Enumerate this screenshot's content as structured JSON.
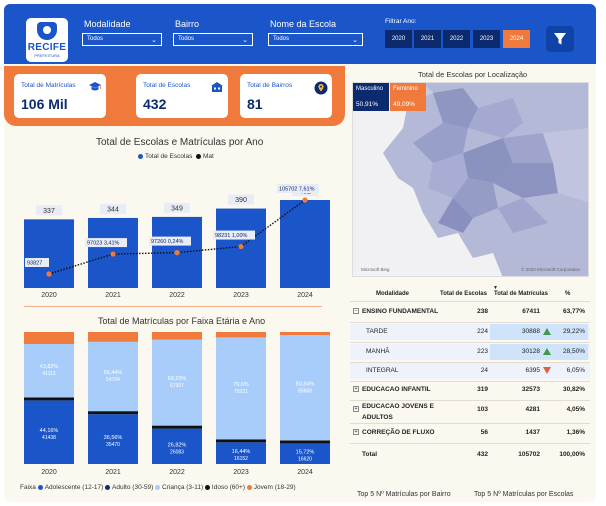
{
  "header": {
    "logo_text": "RECIFE",
    "logo_sub": "PREFEITURA",
    "filters": [
      {
        "label": "Modalidade",
        "value": "Todos"
      },
      {
        "label": "Bairro",
        "value": "Todos"
      },
      {
        "label": "Nome da Escola",
        "value": "Todos"
      }
    ],
    "year_filter_label": "Filtrar Ano:",
    "years": [
      "2020",
      "2021",
      "2022",
      "2023",
      "2024"
    ],
    "active_year": "2024"
  },
  "kpis": [
    {
      "label": "Total de Matrículas",
      "value": "106 Mil",
      "icon": "graduation-cap-icon"
    },
    {
      "label": "Total de Escolas",
      "value": "432",
      "icon": "school-icon"
    },
    {
      "label": "Total de Bairros",
      "value": "81",
      "icon": "location-pin-icon"
    }
  ],
  "colors": {
    "primary": "#1a55c9",
    "dark": "#0c2a6e",
    "accent": "#f07a3b",
    "light_blue": "#a9cdfa",
    "idoso": "#111111"
  },
  "chart_data": [
    {
      "type": "bar",
      "title": "Total de Escolas e Matrículas por Ano",
      "legend": [
        "Total de Escolas",
        "Mat"
      ],
      "categories": [
        "2020",
        "2021",
        "2022",
        "2023",
        "2024"
      ],
      "series": [
        {
          "name": "Total de Escolas",
          "values": [
            337,
            344,
            349,
            390,
            432
          ]
        },
        {
          "name": "Mat",
          "values": [
            93827,
            97023,
            97260,
            98231,
            105702
          ]
        }
      ],
      "growth_labels": [
        "",
        "3,41%",
        "0,24%",
        "1,00%",
        "7,61%"
      ]
    },
    {
      "type": "bar",
      "title": "Total de Matrículas por Faixa Etária e Ano",
      "legend_title": "Faixa",
      "categories": [
        "2020",
        "2021",
        "2022",
        "2023",
        "2024"
      ],
      "series": [
        {
          "name": "Adolescente (12-17)",
          "values": [
            0,
            0,
            0,
            0,
            0
          ]
        },
        {
          "name": "Adulto (30-59)",
          "values": [
            41438,
            35470,
            26083,
            16152,
            16620
          ]
        },
        {
          "name": "Criança (3-11)",
          "values": [
            41113,
            54704,
            67307,
            78221,
            85668
          ]
        },
        {
          "name": "Idoso (60+)",
          "values": [
            0,
            0,
            0,
            0,
            0
          ]
        },
        {
          "name": "Jovem (18-29)",
          "values": [
            0,
            0,
            0,
            0,
            0
          ]
        }
      ],
      "adulto_pct": [
        "44,16%",
        "36,56%",
        "26,82%",
        "16,44%",
        "15,72%"
      ],
      "crianca_pct": [
        "43,82%",
        "56,44%",
        "69,20%",
        "79,6%",
        "80,84%"
      ]
    }
  ],
  "map": {
    "title": "Total de Escolas por Localização",
    "gender": [
      {
        "label": "Masculino",
        "value": "50,91%"
      },
      {
        "label": "Feminino",
        "value": "49,09%"
      }
    ],
    "copyright": "© 2020 Microsoft Corporation",
    "brand": "Microsoft Bing"
  },
  "table": {
    "headers": [
      "Modalidade",
      "Total de Escolas",
      "Total de Matrículas",
      "%"
    ],
    "rows": [
      {
        "name": "ENSINO FUNDAMENTAL",
        "escolas": "238",
        "matriculas": "67411",
        "pct": "63,77%",
        "level": 0
      },
      {
        "name": "TARDE",
        "escolas": "224",
        "matriculas": "30888",
        "pct": "29,22%",
        "level": 1
      },
      {
        "name": "MANHÃ",
        "escolas": "223",
        "matriculas": "30128",
        "pct": "28,50%",
        "level": 1
      },
      {
        "name": "INTEGRAL",
        "escolas": "24",
        "matriculas": "6395",
        "pct": "6,05%",
        "level": 1
      },
      {
        "name": "EDUCACAO INFANTIL",
        "escolas": "319",
        "matriculas": "32573",
        "pct": "30,82%",
        "level": 0
      },
      {
        "name": "EDUCACAO JOVENS E",
        "name2": "ADULTOS",
        "escolas": "103",
        "matriculas": "4281",
        "pct": "4,05%",
        "level": 0
      },
      {
        "name": "CORREÇÃO DE FLUXO",
        "escolas": "56",
        "matriculas": "1437",
        "pct": "1,36%",
        "level": 0
      }
    ],
    "total": {
      "name": "Total",
      "escolas": "432",
      "matriculas": "105702",
      "pct": "100,00%"
    }
  },
  "bottom_links": [
    "Top 5 Nº Matrículas por Bairro",
    "Top 5 Nº Matrículas por Escolas"
  ]
}
